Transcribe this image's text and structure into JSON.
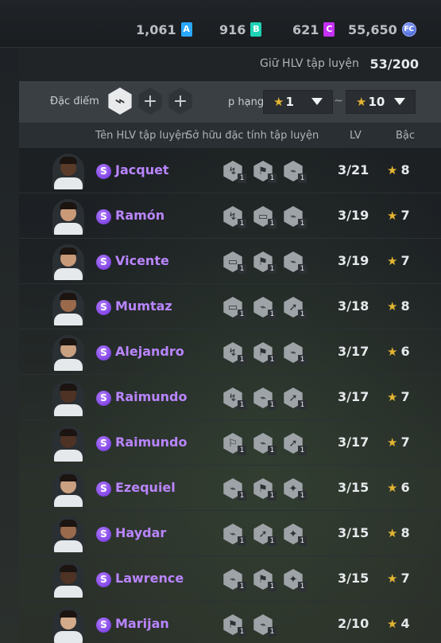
{
  "currencies": [
    {
      "value": "1,061",
      "badge": "A",
      "color": "#2aa8ff"
    },
    {
      "value": "916",
      "badge": "B",
      "color": "#1fd3b5"
    },
    {
      "value": "621",
      "badge": "C",
      "color": "#c531f5"
    },
    {
      "value": "55,650",
      "badge": "FC",
      "color": "#4b67e0"
    }
  ],
  "capacity": {
    "label": "Giữ HLV tập luyện",
    "value": "53/200"
  },
  "filter": {
    "trait_label": "Đặc điểm c",
    "rank_label": "p hạng",
    "min_rank": "1",
    "max_rank": "10",
    "separator": "~",
    "add_symbol": "+"
  },
  "columns": {
    "name": "Tên HLV tập luyện",
    "traits": "Sở hữu đặc tính tập luyện",
    "lv": "LV",
    "grade": "Bậc"
  },
  "colors": {
    "accent_name": "#b985ff",
    "star": "#e3b531"
  },
  "coaches": [
    {
      "name": "Jacquet",
      "lv": "3/21",
      "grade": "8",
      "traits": [
        "↯",
        "⚑",
        "⌁"
      ],
      "levels": [
        "1",
        "1",
        "1"
      ],
      "skin": "#5a3a28"
    },
    {
      "name": "Ramón",
      "lv": "3/19",
      "grade": "7",
      "traits": [
        "↯",
        "▭",
        "⌁"
      ],
      "levels": [
        "1",
        "1",
        "1"
      ],
      "skin": "#c99a78"
    },
    {
      "name": "Vicente",
      "lv": "3/19",
      "grade": "7",
      "traits": [
        "▭",
        "⚑",
        "⌁"
      ],
      "levels": [
        "1",
        "1",
        "1"
      ],
      "skin": "#c99a78"
    },
    {
      "name": "Mumtaz",
      "lv": "3/18",
      "grade": "8",
      "traits": [
        "▭",
        "⌁",
        "➚"
      ],
      "levels": [
        "1",
        "1",
        "1"
      ],
      "skin": "#9a6a4c"
    },
    {
      "name": "Alejandro",
      "lv": "3/17",
      "grade": "6",
      "traits": [
        "↯",
        "⚑",
        "⌁"
      ],
      "levels": [
        "1",
        "1",
        "1"
      ],
      "skin": "#c9a080"
    },
    {
      "name": "Raimundo",
      "lv": "3/17",
      "grade": "7",
      "traits": [
        "↯",
        "⌁",
        "➚"
      ],
      "levels": [
        "1",
        "1",
        "1"
      ],
      "skin": "#4e3224"
    },
    {
      "name": "Raimundo",
      "lv": "3/17",
      "grade": "7",
      "traits": [
        "⚐",
        "⌁",
        "➚"
      ],
      "levels": [
        "1",
        "1",
        "1"
      ],
      "skin": "#4e3224"
    },
    {
      "name": "Ezequiel",
      "lv": "3/15",
      "grade": "6",
      "traits": [
        "⌁",
        "⚑",
        "✦"
      ],
      "levels": [
        "1",
        "1",
        "1"
      ],
      "skin": "#c9a080"
    },
    {
      "name": "Haydar",
      "lv": "3/15",
      "grade": "8",
      "traits": [
        "⌁",
        "➚",
        "✦"
      ],
      "levels": [
        "1",
        "1",
        "1"
      ],
      "skin": "#9a6a4c"
    },
    {
      "name": "Lawrence",
      "lv": "3/15",
      "grade": "7",
      "traits": [
        "⌁",
        "⚑",
        "✦"
      ],
      "levels": [
        "1",
        "1",
        "1"
      ],
      "skin": "#4e3224"
    },
    {
      "name": "Marijan",
      "lv": "2/10",
      "grade": "4",
      "traits": [
        "⚑",
        "⌁"
      ],
      "levels": [
        "1",
        "1"
      ],
      "skin": "#d4ab8a"
    }
  ]
}
